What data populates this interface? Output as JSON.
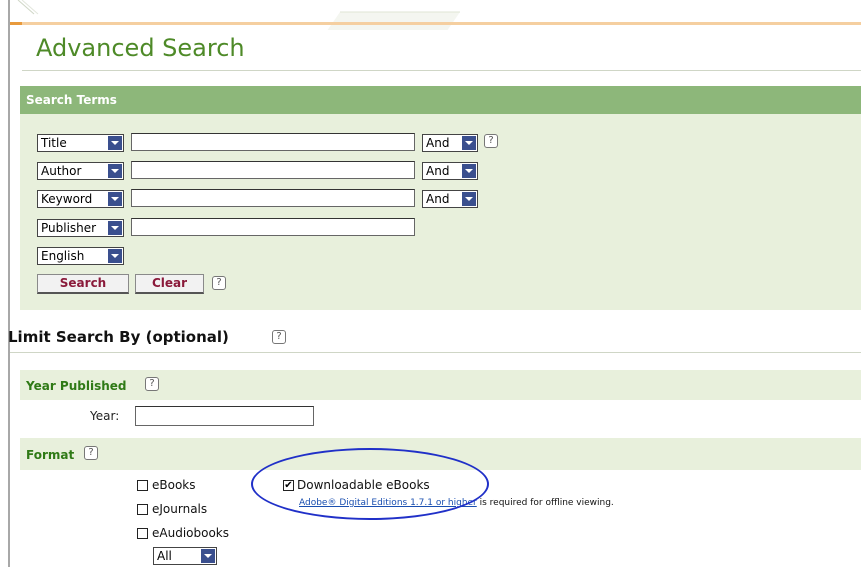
{
  "title": "Advanced Search",
  "search_terms": {
    "header": "Search Terms",
    "rows": [
      {
        "field": "Title",
        "value": "",
        "operator": "And"
      },
      {
        "field": "Author",
        "value": "",
        "operator": "And"
      },
      {
        "field": "Keyword",
        "value": "",
        "operator": "And"
      },
      {
        "field": "Publisher",
        "value": ""
      }
    ],
    "language": "English",
    "search_label": "Search",
    "clear_label": "Clear",
    "help_glyph": "?"
  },
  "limit": {
    "title": "Limit Search By (optional)",
    "year_section": {
      "label": "Year Published",
      "field_label": "Year:",
      "value": ""
    },
    "format_section": {
      "label": "Format",
      "options": [
        {
          "label": "eBooks",
          "checked": false
        },
        {
          "label": "eJournals",
          "checked": false
        },
        {
          "label": "eAudiobooks",
          "checked": false
        },
        {
          "label": "Downloadable eBooks",
          "checked": true
        }
      ],
      "audiobook_select": "All",
      "note_link": "Adobe® Digital Editions 1.7.1 or higher",
      "note_text": " is required for offline viewing."
    }
  },
  "colors": {
    "title_green": "#4e8a28",
    "header_green": "#8db77a",
    "panel_green": "#e8f0dc",
    "button_text": "#8a1a3a",
    "annotation_circle": "#2030c8",
    "link_blue": "#1a4fb0"
  },
  "icons": [
    "help-icon",
    "dropdown-arrow-icon",
    "checkbox-icon",
    "check-mark-icon"
  ]
}
